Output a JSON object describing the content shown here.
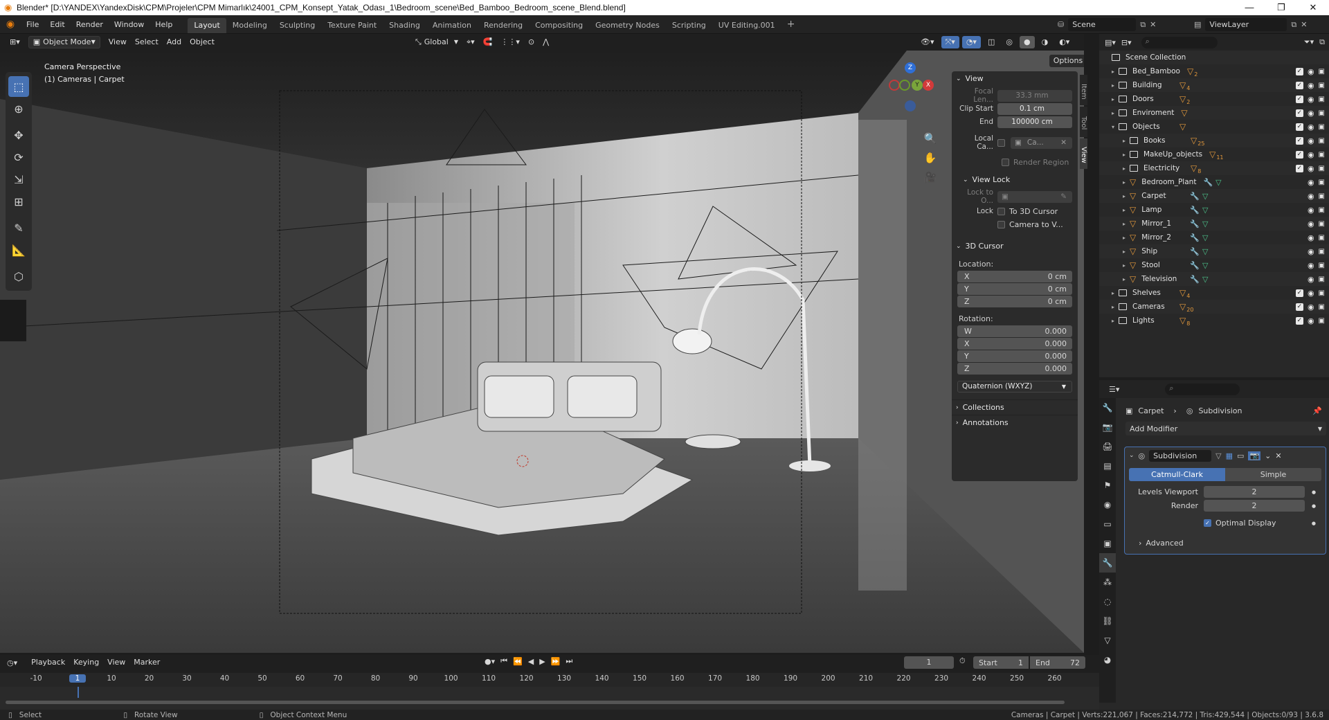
{
  "titlebar": {
    "title": "Blender* [D:\\YANDEX\\YandexDisk\\CPM\\Projeler\\CPM Mimarlık\\24001_CPM_Konsept_Yatak_Odası_1\\Bedroom_scene\\Bed_Bamboo_Bedroom_scene_Blend.blend]",
    "minimize": "—",
    "maximize": "❐",
    "close": "✕"
  },
  "menu": [
    "File",
    "Edit",
    "Render",
    "Window",
    "Help"
  ],
  "workspaces": [
    "Layout",
    "Modeling",
    "Sculpting",
    "Texture Paint",
    "Shading",
    "Animation",
    "Rendering",
    "Compositing",
    "Geometry Nodes",
    "Scripting",
    "UV Editing.001"
  ],
  "active_workspace": "Layout",
  "add_workspace": "+",
  "scene": {
    "label": "Scene",
    "viewlayer": "ViewLayer"
  },
  "viewport_header": {
    "mode": "Object Mode",
    "menus": [
      "View",
      "Select",
      "Add",
      "Object"
    ],
    "orientation": "Global",
    "options": "Options"
  },
  "viewport": {
    "line1": "Camera Perspective",
    "line2": "(1) Cameras | Carpet"
  },
  "side_tabs": [
    "Item",
    "Tool",
    "View"
  ],
  "npanel": {
    "view_title": "View",
    "focal_label": "Focal Len...",
    "focal_value": "33.3 mm",
    "clip_start_label": "Clip Start",
    "clip_start_value": "0.1 cm",
    "end_label": "End",
    "end_value": "100000 cm",
    "local_camera_label": "Local Ca...",
    "local_camera_value": "Ca...",
    "render_region": "Render Region",
    "view_lock_title": "View Lock",
    "lock_to_label": "Lock to O...",
    "lock_label": "Lock",
    "to_3d_cursor": "To 3D Cursor",
    "camera_to_view": "Camera to V...",
    "cursor_title": "3D Cursor",
    "location_label": "Location:",
    "loc": [
      {
        "axis": "X",
        "value": "0 cm"
      },
      {
        "axis": "Y",
        "value": "0 cm"
      },
      {
        "axis": "Z",
        "value": "0 cm"
      }
    ],
    "rotation_label": "Rotation:",
    "rot": [
      {
        "axis": "W",
        "value": "0.000"
      },
      {
        "axis": "X",
        "value": "0.000"
      },
      {
        "axis": "Y",
        "value": "0.000"
      },
      {
        "axis": "Z",
        "value": "0.000"
      }
    ],
    "rotation_mode": "Quaternion (WXYZ)",
    "collections": "Collections",
    "annotations": "Annotations"
  },
  "outliner": {
    "root": "Scene Collection",
    "rows": [
      {
        "name": "Bed_Bamboo",
        "kind": "collection",
        "indent": 1,
        "sub": "2",
        "expand": "▸"
      },
      {
        "name": "Building",
        "kind": "collection",
        "indent": 1,
        "sub": "4",
        "expand": "▸"
      },
      {
        "name": "Doors",
        "kind": "collection",
        "indent": 1,
        "sub": "2",
        "expand": "▸"
      },
      {
        "name": "Enviroment",
        "kind": "collection",
        "indent": 1,
        "sub": "",
        "expand": "▸"
      },
      {
        "name": "Objects",
        "kind": "collection",
        "indent": 1,
        "sub": "",
        "expand": "▾"
      },
      {
        "name": "Books",
        "kind": "collection",
        "indent": 2,
        "sub": "25",
        "expand": "▸"
      },
      {
        "name": "MakeUp_objects",
        "kind": "collection",
        "indent": 2,
        "sub": "11",
        "expand": "▸"
      },
      {
        "name": "Electricity",
        "kind": "collection",
        "indent": 2,
        "sub": "8",
        "expand": "▸"
      },
      {
        "name": "Bedroom_Plant",
        "kind": "object",
        "indent": 2,
        "sub": "",
        "expand": "▸"
      },
      {
        "name": "Carpet",
        "kind": "object",
        "indent": 2,
        "sub": "",
        "expand": "▸"
      },
      {
        "name": "Lamp",
        "kind": "object",
        "indent": 2,
        "sub": "",
        "expand": "▸"
      },
      {
        "name": "Mirror_1",
        "kind": "object",
        "indent": 2,
        "sub": "",
        "expand": "▸"
      },
      {
        "name": "Mirror_2",
        "kind": "object",
        "indent": 2,
        "sub": "",
        "expand": "▸"
      },
      {
        "name": "Ship",
        "kind": "object",
        "indent": 2,
        "sub": "",
        "expand": "▸"
      },
      {
        "name": "Stool",
        "kind": "object",
        "indent": 2,
        "sub": "",
        "expand": "▸"
      },
      {
        "name": "Television",
        "kind": "object",
        "indent": 2,
        "sub": "",
        "expand": "▸"
      },
      {
        "name": "Shelves",
        "kind": "collection",
        "indent": 1,
        "sub": "4",
        "expand": "▸"
      },
      {
        "name": "Cameras",
        "kind": "collection",
        "indent": 1,
        "sub": "20",
        "expand": "▸"
      },
      {
        "name": "Lights",
        "kind": "collection",
        "indent": 1,
        "sub": "8",
        "expand": "▸"
      }
    ]
  },
  "properties": {
    "breadcrumb_object": "Carpet",
    "breadcrumb_modifier": "Subdivision",
    "add_modifier": "Add Modifier",
    "modifier_name": "Subdivision",
    "catmull": "Catmull-Clark",
    "simple": "Simple",
    "levels_viewport_label": "Levels Viewport",
    "levels_viewport_value": "2",
    "render_label": "Render",
    "render_value": "2",
    "optimal_display": "Optimal Display",
    "advanced": "Advanced"
  },
  "timeline": {
    "menus": [
      "Playback",
      "Keying",
      "View",
      "Marker"
    ],
    "current_frame": "1",
    "start_label": "Start",
    "start_value": "1",
    "end_label": "End",
    "end_value": "72",
    "ticks": [
      "-10",
      "1",
      "10",
      "20",
      "30",
      "40",
      "50",
      "60",
      "70",
      "80",
      "90",
      "100",
      "110",
      "120",
      "130",
      "140",
      "150",
      "160",
      "170",
      "180",
      "190",
      "200",
      "210",
      "220",
      "230",
      "240",
      "250",
      "260"
    ]
  },
  "statusbar": {
    "select": "Select",
    "rotate": "Rotate View",
    "context": "Object Context Menu",
    "stats": "Cameras | Carpet | Verts:221,067 | Faces:214,772 | Tris:429,544 | Objects:0/93 | 3.6.8"
  },
  "colors": {
    "accent": "#4772b3",
    "object_orange": "#e59a3c",
    "modifier_blue": "#5a8fd8",
    "mesh_green": "#4cc38b"
  }
}
